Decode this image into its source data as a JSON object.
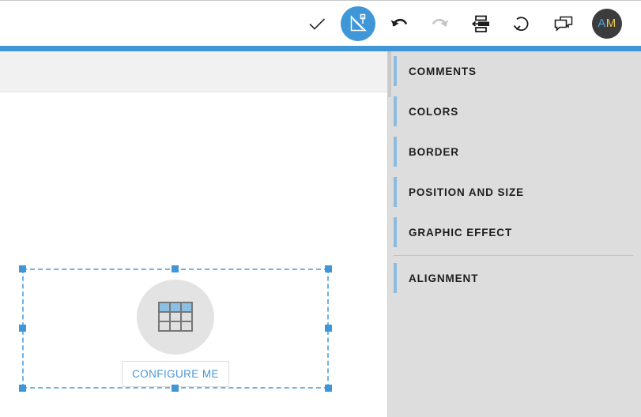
{
  "toolbar": {
    "items": [
      {
        "name": "confirm-check",
        "icon": "check-icon",
        "label": "Confirm",
        "state": "enabled"
      },
      {
        "name": "design-tool",
        "icon": "drafting-ruler-icon",
        "label": "Design Tool",
        "state": "active"
      },
      {
        "name": "undo",
        "icon": "undo-arrow-icon",
        "label": "Undo",
        "state": "enabled"
      },
      {
        "name": "redo",
        "icon": "redo-arrow-icon",
        "label": "Redo",
        "state": "disabled"
      },
      {
        "name": "align-distribute",
        "icon": "align-distribute-icon",
        "label": "Align",
        "state": "enabled"
      },
      {
        "name": "reset-rotate",
        "icon": "rotate-ccw-icon",
        "label": "Reset",
        "state": "enabled"
      },
      {
        "name": "comments",
        "icon": "chat-bubbles-icon",
        "label": "Comments",
        "state": "enabled"
      }
    ],
    "avatar": {
      "initial_first": "A",
      "initial_second": "M",
      "label": "AM"
    }
  },
  "canvas": {
    "widget": {
      "icon": "table-grid-icon",
      "button_label": "CONFIGURE ME",
      "selected": true
    }
  },
  "panel": {
    "items": [
      {
        "label": "COMMENTS",
        "name": "panel-item-comments"
      },
      {
        "label": "COLORS",
        "name": "panel-item-colors"
      },
      {
        "label": "BORDER",
        "name": "panel-item-border"
      },
      {
        "label": "POSITION AND SIZE",
        "name": "panel-item-position-and-size"
      },
      {
        "label": "GRAPHIC EFFECT",
        "name": "panel-item-graphic-effect"
      },
      {
        "label": "ALIGNMENT",
        "name": "panel-item-alignment"
      }
    ],
    "separator_after_index": 4
  },
  "colors": {
    "accent": "#3f97d8",
    "panel_bg": "#dddddd",
    "panel_item_bar": "#8cbbdf",
    "selection": "#6eb3e4",
    "header_bg": "#f1f1f1",
    "avatar_bg": "#3c3c3c",
    "button_text": "#4a96d2"
  }
}
